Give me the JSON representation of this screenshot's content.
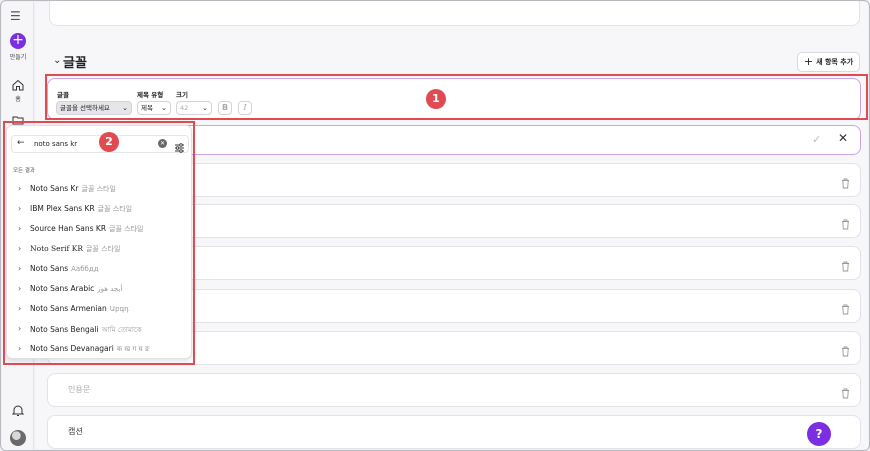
{
  "rail": {
    "create_label": "만들기",
    "home_label": "홈"
  },
  "section": {
    "title": "글꼴",
    "add_button": "새 항목 추가"
  },
  "toolbar": {
    "font_label": "글꼴",
    "font_value": "글꼴을 선택하세요",
    "heading_label": "제목 유형",
    "heading_value": "제목",
    "size_label": "크기",
    "size_value": "42",
    "bold": "B",
    "italic": "I"
  },
  "annotations": {
    "badge1": "1",
    "badge2": "2"
  },
  "dropdown": {
    "query": "noto sans kr",
    "section_label": "모든 결과",
    "items": [
      {
        "name": "Noto Sans Kr",
        "sample": "글꼴 스타일"
      },
      {
        "name": "IBM Plex Sans KR",
        "sample": "글꼴 스타일"
      },
      {
        "name": "Source Han Sans KR",
        "sample": "글꼴 스타일"
      },
      {
        "name": "Noto Serif KR",
        "sample": "글꼴 스타일"
      },
      {
        "name": "Noto Sans",
        "sample": "Ааббдд"
      },
      {
        "name": "Noto Sans Arabic",
        "sample": "أبجد هوز"
      },
      {
        "name": "Noto Sans Armenian",
        "sample": "Աբգդ"
      },
      {
        "name": "Noto Sans Bengali",
        "sample": "আমি তোমাকে"
      },
      {
        "name": "Noto Sans Devanagari",
        "sample": "क ख ग घ ङ"
      }
    ]
  },
  "rows": {
    "quote": "인용문",
    "caption": "캡션"
  },
  "help": "?"
}
